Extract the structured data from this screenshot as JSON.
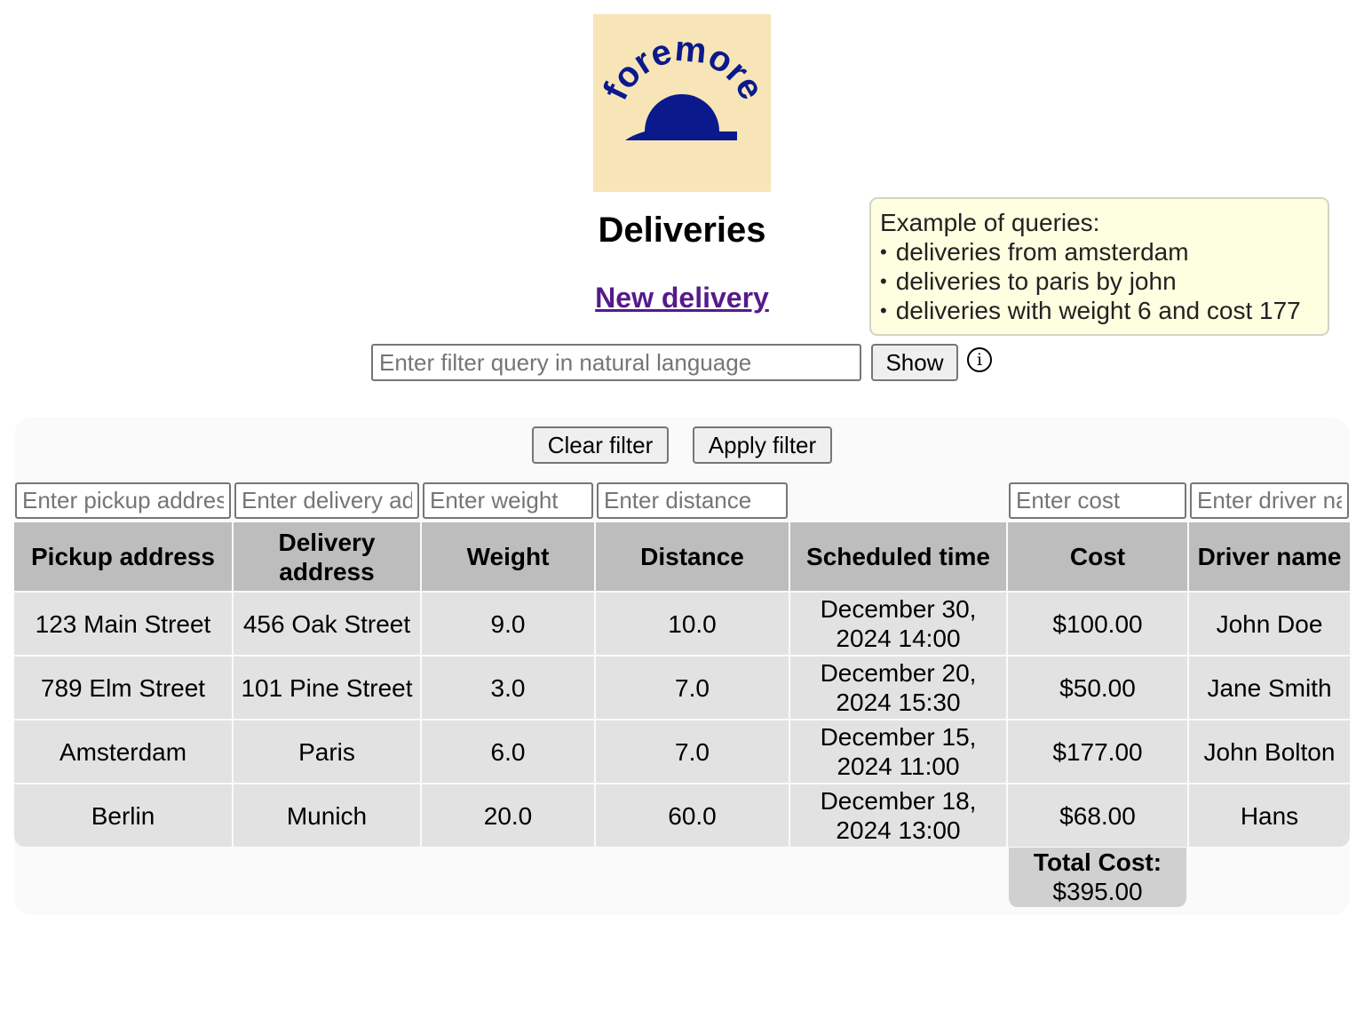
{
  "logo": {
    "text": "foremore",
    "color": "#0a1a8c",
    "background": "#f8e5b7"
  },
  "page_title": "Deliveries",
  "new_delivery_link": "New delivery",
  "tooltip": {
    "heading": "Example of queries:",
    "items": [
      "deliveries from amsterdam",
      "deliveries to paris by john",
      "deliveries with weight 6 and cost 177"
    ]
  },
  "query": {
    "placeholder": "Enter filter query in natural language",
    "show_label": "Show",
    "info_icon": "ⓘ"
  },
  "filters": {
    "clear_label": "Clear filter",
    "apply_label": "Apply filter",
    "pickup_placeholder": "Enter pickup address",
    "delivery_placeholder": "Enter delivery address",
    "weight_placeholder": "Enter weight",
    "distance_placeholder": "Enter distance",
    "cost_placeholder": "Enter cost",
    "driver_placeholder": "Enter driver name"
  },
  "table": {
    "headers": [
      "Pickup address",
      "Delivery address",
      "Weight",
      "Distance",
      "Scheduled time",
      "Cost",
      "Driver name"
    ],
    "rows": [
      [
        "123 Main Street",
        "456 Oak Street",
        "9.0",
        "10.0",
        "December 30, 2024 14:00",
        "$100.00",
        "John Doe"
      ],
      [
        "789 Elm Street",
        "101 Pine Street",
        "3.0",
        "7.0",
        "December 20, 2024 15:30",
        "$50.00",
        "Jane Smith"
      ],
      [
        "Amsterdam",
        "Paris",
        "6.0",
        "7.0",
        "December 15, 2024 11:00",
        "$177.00",
        "John Bolton"
      ],
      [
        "Berlin",
        "Munich",
        "20.0",
        "60.0",
        "December 18, 2024 13:00",
        "$68.00",
        "Hans"
      ]
    ]
  },
  "total": {
    "label": "Total Cost:",
    "value": "$395.00"
  }
}
